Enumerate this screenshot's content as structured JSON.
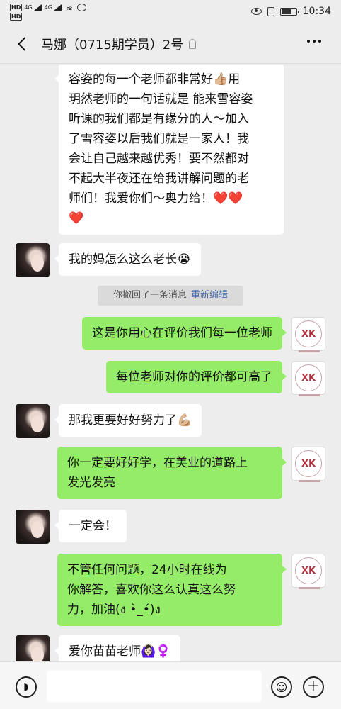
{
  "status_bar": {
    "time": "10:34",
    "hd1": "HD",
    "hd2": "HD",
    "net": "4G"
  },
  "header": {
    "title": "马娜（0715期学员）2号"
  },
  "messages": [
    {
      "side": "in",
      "lines": [
        "容姿的每一个老师都非常好👍🏼用",
        "玥然老师的一句话就是 能来雪容姿",
        "听课的我们都是有缘分的人～加入",
        "了雪容姿以后我们就是一家人！我",
        "会让自己越来越优秀！要不然都对",
        "不起大半夜还在给我讲解问题的老",
        "师们！我爱你们～奥力给！❤️❤️",
        "❤️"
      ]
    },
    {
      "side": "in",
      "text": "我的妈怎么这么老长😭"
    },
    {
      "side": "out",
      "text": "这是你用心在评价我们每一位老师"
    },
    {
      "side": "out",
      "text": "每位老师对你的评价都可高了"
    },
    {
      "side": "in",
      "text": "那我更要好好努力了💪🏼"
    },
    {
      "side": "out",
      "lines": [
        "你一定要好好学，在美业的道路上",
        "发光发亮"
      ]
    },
    {
      "side": "in",
      "text": "一定会！"
    },
    {
      "side": "out",
      "lines": [
        "不管任何问题，24小时在线为",
        "你解答，喜欢你这么认真这么努",
        "力，加油(ง •̀_•́)ง"
      ]
    },
    {
      "side": "in",
      "text": "爱你苗苗老师🙆🏻‍♀️♀️"
    }
  ],
  "system_notice": {
    "text": "你撤回了一条消息",
    "link": "重新编辑"
  },
  "logo_text": "XK",
  "input": {
    "voice_icon": "voice-icon",
    "emoji_icon": "emoji-icon",
    "plus_icon": "plus-icon"
  }
}
